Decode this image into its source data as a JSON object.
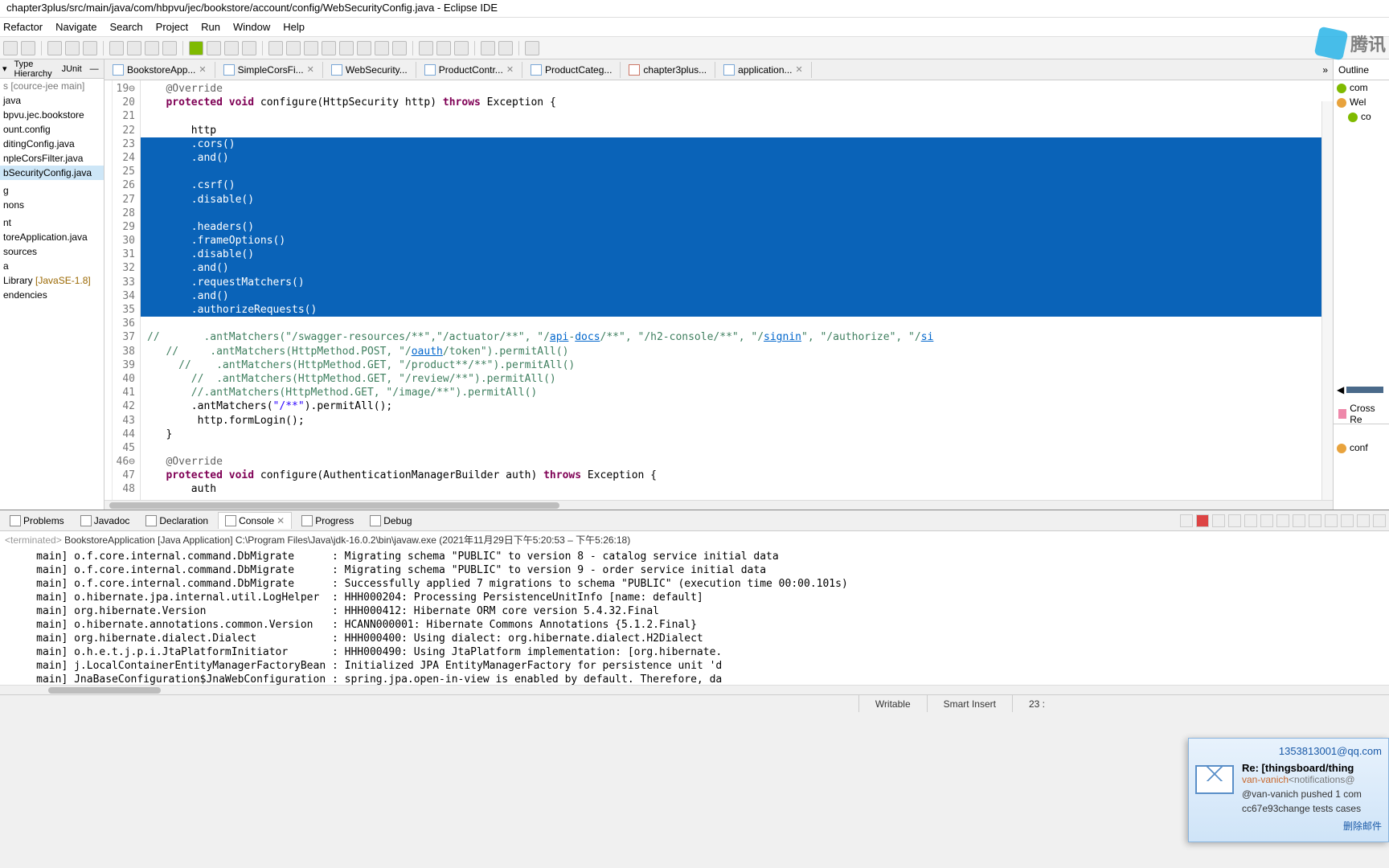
{
  "window": {
    "title": "chapter3plus/src/main/java/com/hbpvu/jec/bookstore/account/config/WebSecurityConfig.java - Eclipse IDE"
  },
  "menu": {
    "refactor": "Refactor",
    "navigate": "Navigate",
    "search": "Search",
    "project": "Project",
    "run": "Run",
    "window": "Window",
    "help": "Help"
  },
  "left": {
    "tabs": {
      "hierarchy": "Type Hierarchy",
      "junit": "JUnit"
    },
    "root_label": "s [cource-jee main]",
    "items": [
      "java",
      "bpvu.jec.bookstore",
      "ount.config",
      "ditingConfig.java",
      "npleCorsFilter.java",
      "bSecurityConfig.java",
      "",
      "g",
      "nons",
      "",
      "nt",
      "toreApplication.java",
      "sources",
      "a"
    ],
    "jre": {
      "label": "Library",
      "ver": "[JavaSE-1.8]"
    },
    "dep": "endencies"
  },
  "tabs": [
    {
      "label": "BookstoreApp...",
      "close": true
    },
    {
      "label": "SimpleCorsFi...",
      "close": true
    },
    {
      "label": "WebSecurity...",
      "close": false
    },
    {
      "label": "ProductContr...",
      "close": true
    },
    {
      "label": "ProductCateg...",
      "close": false
    },
    {
      "label": "chapter3plus...",
      "xml": true
    },
    {
      "label": "application...",
      "close": true
    }
  ],
  "lines": {
    "start": 19,
    "rows": [
      {
        "n": "19",
        "html": "   <span class='ann'>@Override</span>",
        "collapse": true
      },
      {
        "n": "20",
        "html": "   <span class='kw'>protected</span> <span class='kw'>void</span> configure(HttpSecurity http) <span class='kw'>throws</span> Exception {"
      },
      {
        "n": "21",
        "html": ""
      },
      {
        "n": "22",
        "html": "       http"
      },
      {
        "n": "23",
        "html": "       .cors()",
        "sel": true
      },
      {
        "n": "24",
        "html": "       .and()",
        "sel": true
      },
      {
        "n": "25",
        "html": "",
        "sel": true
      },
      {
        "n": "26",
        "html": "       .csrf()",
        "sel": true
      },
      {
        "n": "27",
        "html": "       .disable()",
        "sel": true
      },
      {
        "n": "28",
        "html": "",
        "sel": true
      },
      {
        "n": "29",
        "html": "       .headers()",
        "sel": true
      },
      {
        "n": "30",
        "html": "       .frameOptions()",
        "sel": true
      },
      {
        "n": "31",
        "html": "       .disable()",
        "sel": true
      },
      {
        "n": "32",
        "html": "       .and()",
        "sel": true
      },
      {
        "n": "33",
        "html": "       .requestMatchers()",
        "sel": true
      },
      {
        "n": "34",
        "html": "       .and()",
        "sel": true
      },
      {
        "n": "35",
        "html": "       .authorizeRequests()",
        "sel": true
      },
      {
        "n": "36",
        "html": ""
      },
      {
        "n": "37",
        "html": "<span class='cm'>//       .antMatchers(\"/swagger-resources/**\",\"/actuator/**\", \"/<span class='link'>api</span>-<span class='link'>docs</span>/**\", \"/h2-console/**\", \"/<span class='link'>signin</span>\", \"/authorize\", \"/<span class='link'>si</span></span>"
      },
      {
        "n": "38",
        "html": "   <span class='cm'>//     .antMatchers(HttpMethod.POST, \"/<span class='link'>oauth</span>/token\").permitAll()</span>"
      },
      {
        "n": "39",
        "html": "     <span class='cm'>//    .antMatchers(HttpMethod.GET, \"/product**/**\").permitAll()</span>"
      },
      {
        "n": "40",
        "html": "       <span class='cm'>//  .antMatchers(HttpMethod.GET, \"/review/**\").permitAll()</span>"
      },
      {
        "n": "41",
        "html": "       <span class='cm'>//.antMatchers(HttpMethod.GET, \"/image/**\").permitAll()</span>"
      },
      {
        "n": "42",
        "html": "       .antMatchers(<span class='str'>\"/**\"</span>).permitAll();"
      },
      {
        "n": "43",
        "html": "        http.formLogin();"
      },
      {
        "n": "44",
        "html": "   }"
      },
      {
        "n": "45",
        "html": ""
      },
      {
        "n": "46",
        "html": "   <span class='ann'>@Override</span>",
        "collapse": true
      },
      {
        "n": "47",
        "html": "   <span class='kw'>protected</span> <span class='kw'>void</span> configure(AuthenticationManagerBuilder auth) <span class='kw'>throws</span> Exception {"
      },
      {
        "n": "48",
        "html": "       auth"
      }
    ]
  },
  "outline": {
    "title": "Outline",
    "items": [
      {
        "label": "com",
        "cls": ""
      },
      {
        "label": "Wel",
        "cls": "orange"
      },
      {
        "label": "co",
        "cls": ""
      }
    ],
    "cross": "Cross Re",
    "conf": "conf"
  },
  "bottom": {
    "tabs": {
      "problems": "Problems",
      "javadoc": "Javadoc",
      "declaration": "Declaration",
      "console": "Console",
      "progress": "Progress",
      "debug": "Debug"
    },
    "header": {
      "term": "<terminated>",
      "desc": "BookstoreApplication [Java Application] C:\\Program Files\\Java\\jdk-16.0.2\\bin\\javaw.exe (2021年11月29日下午5:20:53 – 下午5:26:18)"
    },
    "lines": [
      "main] o.f.core.internal.command.DbMigrate      : Migrating schema \"PUBLIC\" to version 8 - catalog service initial data",
      "main] o.f.core.internal.command.DbMigrate      : Migrating schema \"PUBLIC\" to version 9 - order service initial data",
      "main] o.f.core.internal.command.DbMigrate      : Successfully applied 7 migrations to schema \"PUBLIC\" (execution time 00:00.101s)",
      "main] o.hibernate.jpa.internal.util.LogHelper  : HHH000204: Processing PersistenceUnitInfo [name: default]",
      "main] org.hibernate.Version                    : HHH000412: Hibernate ORM core version 5.4.32.Final",
      "main] o.hibernate.annotations.common.Version   : HCANN000001: Hibernate Commons Annotations {5.1.2.Final}",
      "main] org.hibernate.dialect.Dialect            : HHH000400: Using dialect: org.hibernate.dialect.H2Dialect",
      "main] o.h.e.t.j.p.i.JtaPlatformInitiator       : HHH000490: Using JtaPlatform implementation: [org.hibernate.",
      "main] j.LocalContainerEntityManagerFactoryBean : Initialized JPA EntityManagerFactory for persistence unit 'd",
      "main] JnaBaseConfiguration$JnaWebConfiguration : spring.jpa.open-in-view is enabled by default. Therefore, da"
    ]
  },
  "status": {
    "writable": "Writable",
    "insert": "Smart Insert",
    "cursor": "23 :"
  },
  "notif": {
    "from": "1353813001@qq.com",
    "subject": "Re: [thingsboard/thing",
    "sender_name": "van-vanich",
    "sender_email": "<notifications@",
    "line1": "@van-vanich pushed 1 com",
    "line2": "cc67e93change tests cases",
    "delete": "删除邮件"
  },
  "logo": {
    "text": "腾讯"
  }
}
